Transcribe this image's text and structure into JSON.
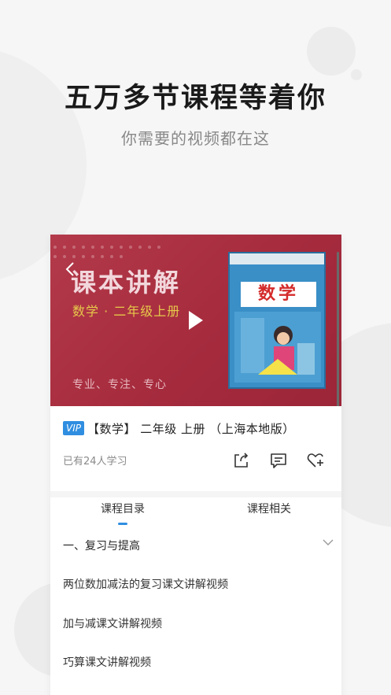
{
  "promo": {
    "headline": "五万多节课程等着你",
    "subline": "你需要的视频都在这"
  },
  "video": {
    "title": "课本讲解",
    "subtitle": "数学 · 二年级上册",
    "slogan": "专业、专注、专心",
    "book_title": "数学",
    "icons": {
      "back": "back-icon",
      "play": "play-icon"
    }
  },
  "course": {
    "vip_badge": "VIP",
    "title": "【数学】 二年级 上册 （上海本地版）",
    "learners": "已有24人学习",
    "icons": {
      "share": "share-icon",
      "comment": "comment-icon",
      "favorite": "heart-plus-icon"
    }
  },
  "tabs": [
    {
      "label": "课程目录",
      "active": true
    },
    {
      "label": "课程相关",
      "active": false
    }
  ],
  "catalog": {
    "section": "一、复习与提高",
    "lessons": [
      "两位数加减法的复习课文讲解视频",
      "加与减课文讲解视频",
      "巧算课文讲解视频"
    ]
  },
  "colors": {
    "accent": "#2f8ee0",
    "video_bg": "#a52b3d"
  }
}
